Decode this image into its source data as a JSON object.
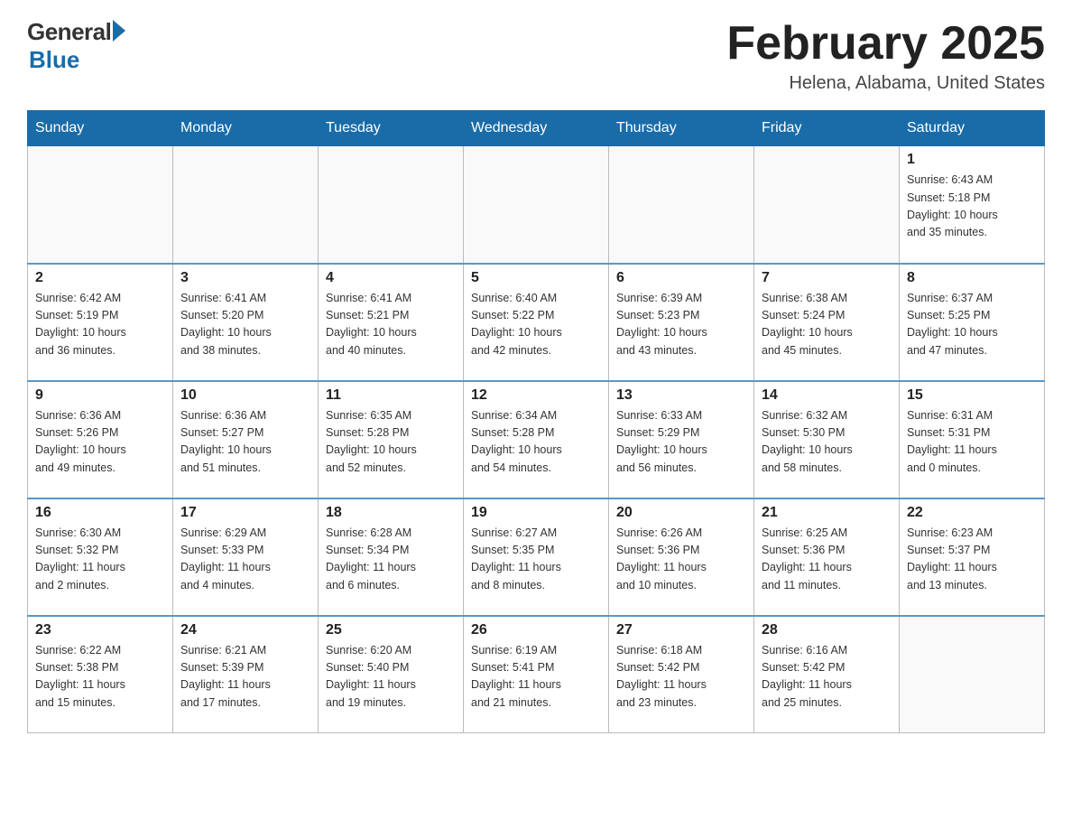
{
  "header": {
    "logo_general": "General",
    "logo_blue": "Blue",
    "month_title": "February 2025",
    "location": "Helena, Alabama, United States"
  },
  "days_of_week": [
    "Sunday",
    "Monday",
    "Tuesday",
    "Wednesday",
    "Thursday",
    "Friday",
    "Saturday"
  ],
  "weeks": [
    [
      {
        "day": "",
        "info": ""
      },
      {
        "day": "",
        "info": ""
      },
      {
        "day": "",
        "info": ""
      },
      {
        "day": "",
        "info": ""
      },
      {
        "day": "",
        "info": ""
      },
      {
        "day": "",
        "info": ""
      },
      {
        "day": "1",
        "info": "Sunrise: 6:43 AM\nSunset: 5:18 PM\nDaylight: 10 hours\nand 35 minutes."
      }
    ],
    [
      {
        "day": "2",
        "info": "Sunrise: 6:42 AM\nSunset: 5:19 PM\nDaylight: 10 hours\nand 36 minutes."
      },
      {
        "day": "3",
        "info": "Sunrise: 6:41 AM\nSunset: 5:20 PM\nDaylight: 10 hours\nand 38 minutes."
      },
      {
        "day": "4",
        "info": "Sunrise: 6:41 AM\nSunset: 5:21 PM\nDaylight: 10 hours\nand 40 minutes."
      },
      {
        "day": "5",
        "info": "Sunrise: 6:40 AM\nSunset: 5:22 PM\nDaylight: 10 hours\nand 42 minutes."
      },
      {
        "day": "6",
        "info": "Sunrise: 6:39 AM\nSunset: 5:23 PM\nDaylight: 10 hours\nand 43 minutes."
      },
      {
        "day": "7",
        "info": "Sunrise: 6:38 AM\nSunset: 5:24 PM\nDaylight: 10 hours\nand 45 minutes."
      },
      {
        "day": "8",
        "info": "Sunrise: 6:37 AM\nSunset: 5:25 PM\nDaylight: 10 hours\nand 47 minutes."
      }
    ],
    [
      {
        "day": "9",
        "info": "Sunrise: 6:36 AM\nSunset: 5:26 PM\nDaylight: 10 hours\nand 49 minutes."
      },
      {
        "day": "10",
        "info": "Sunrise: 6:36 AM\nSunset: 5:27 PM\nDaylight: 10 hours\nand 51 minutes."
      },
      {
        "day": "11",
        "info": "Sunrise: 6:35 AM\nSunset: 5:28 PM\nDaylight: 10 hours\nand 52 minutes."
      },
      {
        "day": "12",
        "info": "Sunrise: 6:34 AM\nSunset: 5:28 PM\nDaylight: 10 hours\nand 54 minutes."
      },
      {
        "day": "13",
        "info": "Sunrise: 6:33 AM\nSunset: 5:29 PM\nDaylight: 10 hours\nand 56 minutes."
      },
      {
        "day": "14",
        "info": "Sunrise: 6:32 AM\nSunset: 5:30 PM\nDaylight: 10 hours\nand 58 minutes."
      },
      {
        "day": "15",
        "info": "Sunrise: 6:31 AM\nSunset: 5:31 PM\nDaylight: 11 hours\nand 0 minutes."
      }
    ],
    [
      {
        "day": "16",
        "info": "Sunrise: 6:30 AM\nSunset: 5:32 PM\nDaylight: 11 hours\nand 2 minutes."
      },
      {
        "day": "17",
        "info": "Sunrise: 6:29 AM\nSunset: 5:33 PM\nDaylight: 11 hours\nand 4 minutes."
      },
      {
        "day": "18",
        "info": "Sunrise: 6:28 AM\nSunset: 5:34 PM\nDaylight: 11 hours\nand 6 minutes."
      },
      {
        "day": "19",
        "info": "Sunrise: 6:27 AM\nSunset: 5:35 PM\nDaylight: 11 hours\nand 8 minutes."
      },
      {
        "day": "20",
        "info": "Sunrise: 6:26 AM\nSunset: 5:36 PM\nDaylight: 11 hours\nand 10 minutes."
      },
      {
        "day": "21",
        "info": "Sunrise: 6:25 AM\nSunset: 5:36 PM\nDaylight: 11 hours\nand 11 minutes."
      },
      {
        "day": "22",
        "info": "Sunrise: 6:23 AM\nSunset: 5:37 PM\nDaylight: 11 hours\nand 13 minutes."
      }
    ],
    [
      {
        "day": "23",
        "info": "Sunrise: 6:22 AM\nSunset: 5:38 PM\nDaylight: 11 hours\nand 15 minutes."
      },
      {
        "day": "24",
        "info": "Sunrise: 6:21 AM\nSunset: 5:39 PM\nDaylight: 11 hours\nand 17 minutes."
      },
      {
        "day": "25",
        "info": "Sunrise: 6:20 AM\nSunset: 5:40 PM\nDaylight: 11 hours\nand 19 minutes."
      },
      {
        "day": "26",
        "info": "Sunrise: 6:19 AM\nSunset: 5:41 PM\nDaylight: 11 hours\nand 21 minutes."
      },
      {
        "day": "27",
        "info": "Sunrise: 6:18 AM\nSunset: 5:42 PM\nDaylight: 11 hours\nand 23 minutes."
      },
      {
        "day": "28",
        "info": "Sunrise: 6:16 AM\nSunset: 5:42 PM\nDaylight: 11 hours\nand 25 minutes."
      },
      {
        "day": "",
        "info": ""
      }
    ]
  ]
}
